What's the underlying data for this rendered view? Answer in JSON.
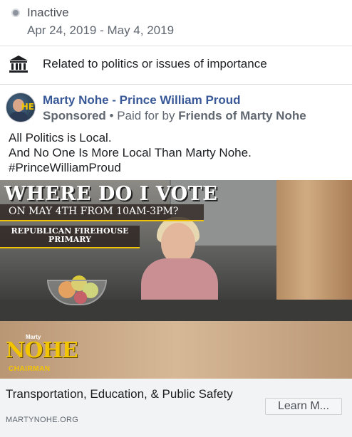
{
  "status": {
    "label": "Inactive",
    "date_range": "Apr 24, 2019 - May 4, 2019"
  },
  "category": {
    "icon": "government-building-icon",
    "label": "Related to politics or issues of importance"
  },
  "ad": {
    "page_name": "Marty Nohe - Prince William Proud",
    "sponsored": "Sponsored",
    "separator": " • ",
    "paid_for_prefix": "Paid for by ",
    "paid_for_by": "Friends of Marty Nohe",
    "body_lines": [
      "All Politics is Local.",
      "And No One Is More Local Than Marty Nohe.",
      "#PrinceWilliamProud"
    ],
    "image": {
      "headline": "WHERE DO I VOTE",
      "subhead": "ON MAY 4TH FROM 10AM-3PM?",
      "primary_line1": "REPUBLICAN FIREHOUSE",
      "primary_line2": "PRIMARY",
      "logo_small": "Marty",
      "logo_main": "NOHE",
      "logo_sub": "CHAIRMAN"
    },
    "link_title": "Transportation, Education, & Public Safety",
    "link_domain": "MARTYNOHE.ORG",
    "cta_label": "Learn M..."
  },
  "colors": {
    "link_blue": "#385898",
    "secondary_text": "#606770",
    "brand_yellow": "#f2c500"
  }
}
